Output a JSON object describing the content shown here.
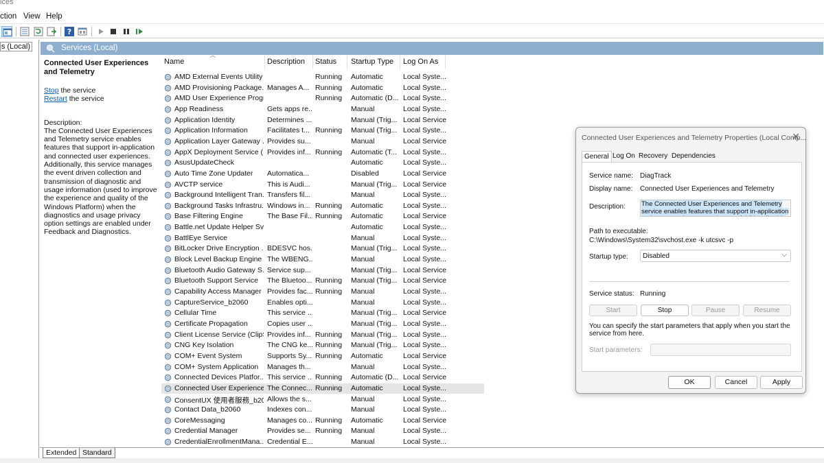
{
  "window": {
    "title_fragment": "ices"
  },
  "menu": [
    "ction",
    "View",
    "Help"
  ],
  "tree": {
    "item": "ces (Local)"
  },
  "header": {
    "title": "Services (Local)"
  },
  "details": {
    "service_title": "Connected User Experiences and Telemetry",
    "stop_link": "Stop",
    "stop_suffix": " the service",
    "restart_link": "Restart",
    "restart_suffix": " the service",
    "description_label": "Description:",
    "description": "The Connected User Experiences and Telemetry service enables features that support in-application and connected user experiences. Additionally, this service manages the event driven collection and transmission of diagnostic and usage information (used to improve the experience and quality of the Windows Platform) when the diagnostics and usage privacy option settings are enabled under Feedback and Diagnostics."
  },
  "table": {
    "columns": [
      "Name",
      "Description",
      "Status",
      "Startup Type",
      "Log On As"
    ],
    "rows": [
      [
        "AMD External Events Utility",
        "",
        "Running",
        "Automatic",
        "Local Syste..."
      ],
      [
        "AMD Provisioning Package...",
        "Manages A...",
        "Running",
        "Automatic",
        "Local Syste..."
      ],
      [
        "AMD User Experience Progr...",
        "",
        "Running",
        "Automatic (D...",
        "Local Syste..."
      ],
      [
        "App Readiness",
        "Gets apps re...",
        "",
        "Manual",
        "Local Syste..."
      ],
      [
        "Application Identity",
        "Determines ...",
        "",
        "Manual (Trig...",
        "Local Service"
      ],
      [
        "Application Information",
        "Facilitates t...",
        "Running",
        "Manual (Trig...",
        "Local Syste..."
      ],
      [
        "Application Layer Gateway ...",
        "Provides su...",
        "",
        "Manual",
        "Local Service"
      ],
      [
        "AppX Deployment Service (...",
        "Provides inf...",
        "Running",
        "Automatic (T...",
        "Local Syste..."
      ],
      [
        "AsusUpdateCheck",
        "",
        "",
        "Automatic",
        "Local Syste..."
      ],
      [
        "Auto Time Zone Updater",
        "Automatica...",
        "",
        "Disabled",
        "Local Service"
      ],
      [
        "AVCTP service",
        "This is Audi...",
        "",
        "Manual (Trig...",
        "Local Service"
      ],
      [
        "Background Intelligent Tran...",
        "Transfers fil...",
        "",
        "Manual",
        "Local Syste..."
      ],
      [
        "Background Tasks Infrastru...",
        "Windows in...",
        "Running",
        "Automatic",
        "Local Syste..."
      ],
      [
        "Base Filtering Engine",
        "The Base Fil...",
        "Running",
        "Automatic",
        "Local Service"
      ],
      [
        "Battle.net Update Helper Svc",
        "",
        "",
        "Automatic",
        "Local Syste..."
      ],
      [
        "BattlEye Service",
        "",
        "",
        "Manual",
        "Local Syste..."
      ],
      [
        "BitLocker Drive Encryption ...",
        "BDESVC hos...",
        "",
        "Manual (Trig...",
        "Local Syste..."
      ],
      [
        "Block Level Backup Engine ...",
        "The WBENG...",
        "",
        "Manual",
        "Local Syste..."
      ],
      [
        "Bluetooth Audio Gateway S...",
        "Service sup...",
        "",
        "Manual (Trig...",
        "Local Service"
      ],
      [
        "Bluetooth Support Service",
        "The Bluetoo...",
        "Running",
        "Manual (Trig...",
        "Local Service"
      ],
      [
        "Capability Access Manager ...",
        "Provides fac...",
        "Running",
        "Manual",
        "Local Syste..."
      ],
      [
        "CaptureService_b2060",
        "Enables opti...",
        "",
        "Manual",
        "Local Syste..."
      ],
      [
        "Cellular Time",
        "This service ...",
        "",
        "Manual (Trig...",
        "Local Service"
      ],
      [
        "Certificate Propagation",
        "Copies user ...",
        "",
        "Manual (Trig...",
        "Local Syste..."
      ],
      [
        "Client License Service (ClipS...",
        "Provides inf...",
        "Running",
        "Manual (Trig...",
        "Local Syste..."
      ],
      [
        "CNG Key Isolation",
        "The CNG ke...",
        "Running",
        "Manual (Trig...",
        "Local Syste..."
      ],
      [
        "COM+ Event System",
        "Supports Sy...",
        "Running",
        "Automatic",
        "Local Service"
      ],
      [
        "COM+ System Application",
        "Manages th...",
        "",
        "Manual",
        "Local Syste..."
      ],
      [
        "Connected Devices Platfor...",
        "This service ...",
        "Running",
        "Automatic (D...",
        "Local Service"
      ],
      [
        "Connected User Experience...",
        "The Connec...",
        "Running",
        "Automatic",
        "Local Syste..."
      ],
      [
        "ConsentUX 使用者服務_b2060",
        "Allows the s...",
        "",
        "Manual",
        "Local Syste..."
      ],
      [
        "Contact Data_b2060",
        "Indexes con...",
        "",
        "Manual",
        "Local Syste..."
      ],
      [
        "CoreMessaging",
        "Manages co...",
        "Running",
        "Automatic",
        "Local Service"
      ],
      [
        "Credential Manager",
        "Provides se...",
        "Running",
        "Manual",
        "Local Syste..."
      ],
      [
        "CredentialEnrollmentMana...",
        "Credential E...",
        "",
        "Manual",
        "Local Syste..."
      ]
    ],
    "selected_row": 29
  },
  "bottom_tabs": [
    "Extended",
    "Standard"
  ],
  "dialog": {
    "title": "Connected User Experiences and Telemetry Properties (Local Comp...",
    "close": "✕",
    "tabs": [
      "General",
      "Log On",
      "Recovery",
      "Dependencies"
    ],
    "service_name_label": "Service name:",
    "service_name": "DiagTrack",
    "display_name_label": "Display name:",
    "display_name": "Connected User Experiences and Telemetry",
    "description_label": "Description:",
    "description": "The Connected User Experiences and Telemetry service enables features that support in-application and connected user experiences. Additionally, this",
    "path_label": "Path to executable:",
    "path": "C:\\Windows\\System32\\svchost.exe -k utcsvc -p",
    "startup_type_label": "Startup type:",
    "startup_type": "Disabled",
    "service_status_label": "Service status:",
    "service_status": "Running",
    "buttons": [
      "Start",
      "Stop",
      "Pause",
      "Resume"
    ],
    "hint": "You can specify the start parameters that apply when you start the service from here.",
    "start_params_label": "Start parameters:",
    "footer": [
      "OK",
      "Cancel",
      "Apply"
    ]
  },
  "colors": {
    "header_band": "#8eaed0",
    "link": "#0b5cad",
    "selection": "#e5e5e5"
  },
  "icons": [
    "view-console-icon",
    "view-list-icon",
    "refresh-icon",
    "export-icon",
    "help-icon",
    "properties-icon",
    "play-icon",
    "stop-icon",
    "pause-icon",
    "restart-icon",
    "gear-icon",
    "search-icon",
    "close-icon",
    "chevron-down-icon"
  ]
}
